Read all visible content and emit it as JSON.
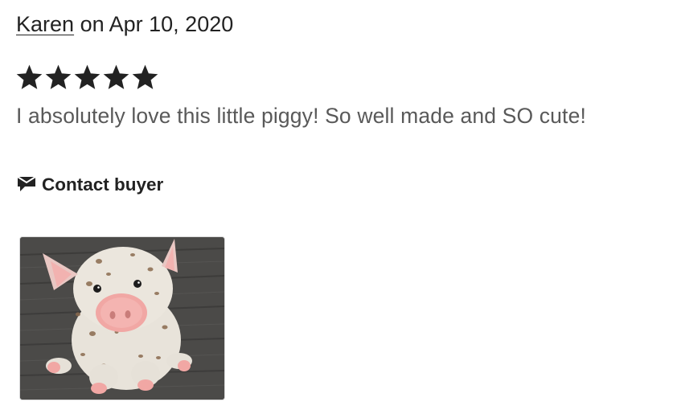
{
  "review": {
    "reviewer_name": "Karen",
    "date_text": "on Apr 10, 2020",
    "rating": 5,
    "rating_max": 5,
    "text": "I absolutely love this little piggy! So well made and SO cute!",
    "contact_label": "Contact buyer",
    "contact_icon": "envelope-icon",
    "photo_icon": "review-photo"
  },
  "colors": {
    "text_primary": "#222222",
    "text_secondary": "#595959",
    "star": "#222222"
  }
}
